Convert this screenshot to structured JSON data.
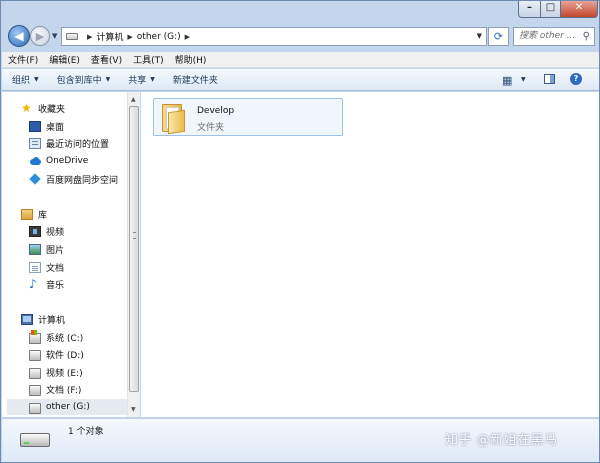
{
  "window_controls": {
    "minimize": "–",
    "maximize": "□",
    "close": "✕"
  },
  "address_bar": {
    "crumbs": [
      "计算机",
      "other (G:)"
    ],
    "search_placeholder": "搜索 other ..."
  },
  "menu": [
    "文件(F)",
    "编辑(E)",
    "查看(V)",
    "工具(T)",
    "帮助(H)"
  ],
  "toolbar": {
    "organize": "组织",
    "include_in_library": "包含到库中",
    "share": "共享",
    "new_folder": "新建文件夹"
  },
  "nav": {
    "favorites": {
      "label": "收藏夹",
      "items": [
        "桌面",
        "最近访问的位置",
        "OneDrive",
        "百度网盘同步空间"
      ]
    },
    "libraries": {
      "label": "库",
      "items": [
        "视频",
        "图片",
        "文档",
        "音乐"
      ]
    },
    "computer": {
      "label": "计算机",
      "items": [
        "系统 (C:)",
        "软件 (D:)",
        "视频 (E:)",
        "文档 (F:)",
        "other (G:)"
      ]
    }
  },
  "content": {
    "items": [
      {
        "name": "Develop",
        "type": "文件夹"
      }
    ]
  },
  "details": {
    "count": "1 个对象"
  },
  "watermark": "知乎 @新姐在黑马",
  "colors": {
    "accent": "#2d69b5",
    "selection": "#f1f6fd",
    "selection_border": "#9ec3ea"
  }
}
